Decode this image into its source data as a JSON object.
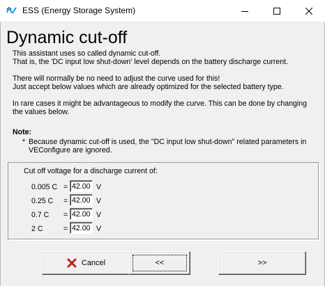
{
  "window": {
    "title": "ESS (Energy Storage System)",
    "icon": "victron-wave-icon",
    "controls": [
      "minimize-icon",
      "maximize-icon",
      "close-icon"
    ]
  },
  "heading": "Dynamic cut-off",
  "intro": {
    "line1": "This assistant uses so called dynamic cut-off.",
    "line2": "That is, the  'DC input low shut-down' level depends on the battery discharge current.",
    "line3": "There will normally be no need to adjust the curve used for this!",
    "line4": "Just accept below values which are already optimized for the selected battery type.",
    "line5": "In rare cases it might be advantageous to modify the curve. This can be done by changing",
    "line6": "the values below."
  },
  "note": {
    "heading": "Note:",
    "bullet": "*",
    "line1": "Because dynamic cut-off is used, the \"DC input low shut-down\" related parameters in",
    "line2": "VEConfigure are ignored."
  },
  "values": {
    "caption": "Cut off voltage for a discharge current of:",
    "rows": [
      {
        "current": "0.005 C",
        "eq": "=",
        "voltage": "42.00",
        "unit": "V"
      },
      {
        "current": "0.25 C",
        "eq": "=",
        "voltage": "42.00",
        "unit": "V"
      },
      {
        "current": "0.7 C",
        "eq": "=",
        "voltage": "42.00",
        "unit": "V"
      },
      {
        "current": "2 C",
        "eq": "=",
        "voltage": "42.00",
        "unit": "V"
      }
    ]
  },
  "buttons": {
    "cancel": "Cancel",
    "cancel_icon": "red-x-icon",
    "back": "<<",
    "next": ">>"
  },
  "colors": {
    "window_bg": "#f0f0f0",
    "titlebar_bg": "#ffffff",
    "cancel_icon": "#c0201a"
  }
}
